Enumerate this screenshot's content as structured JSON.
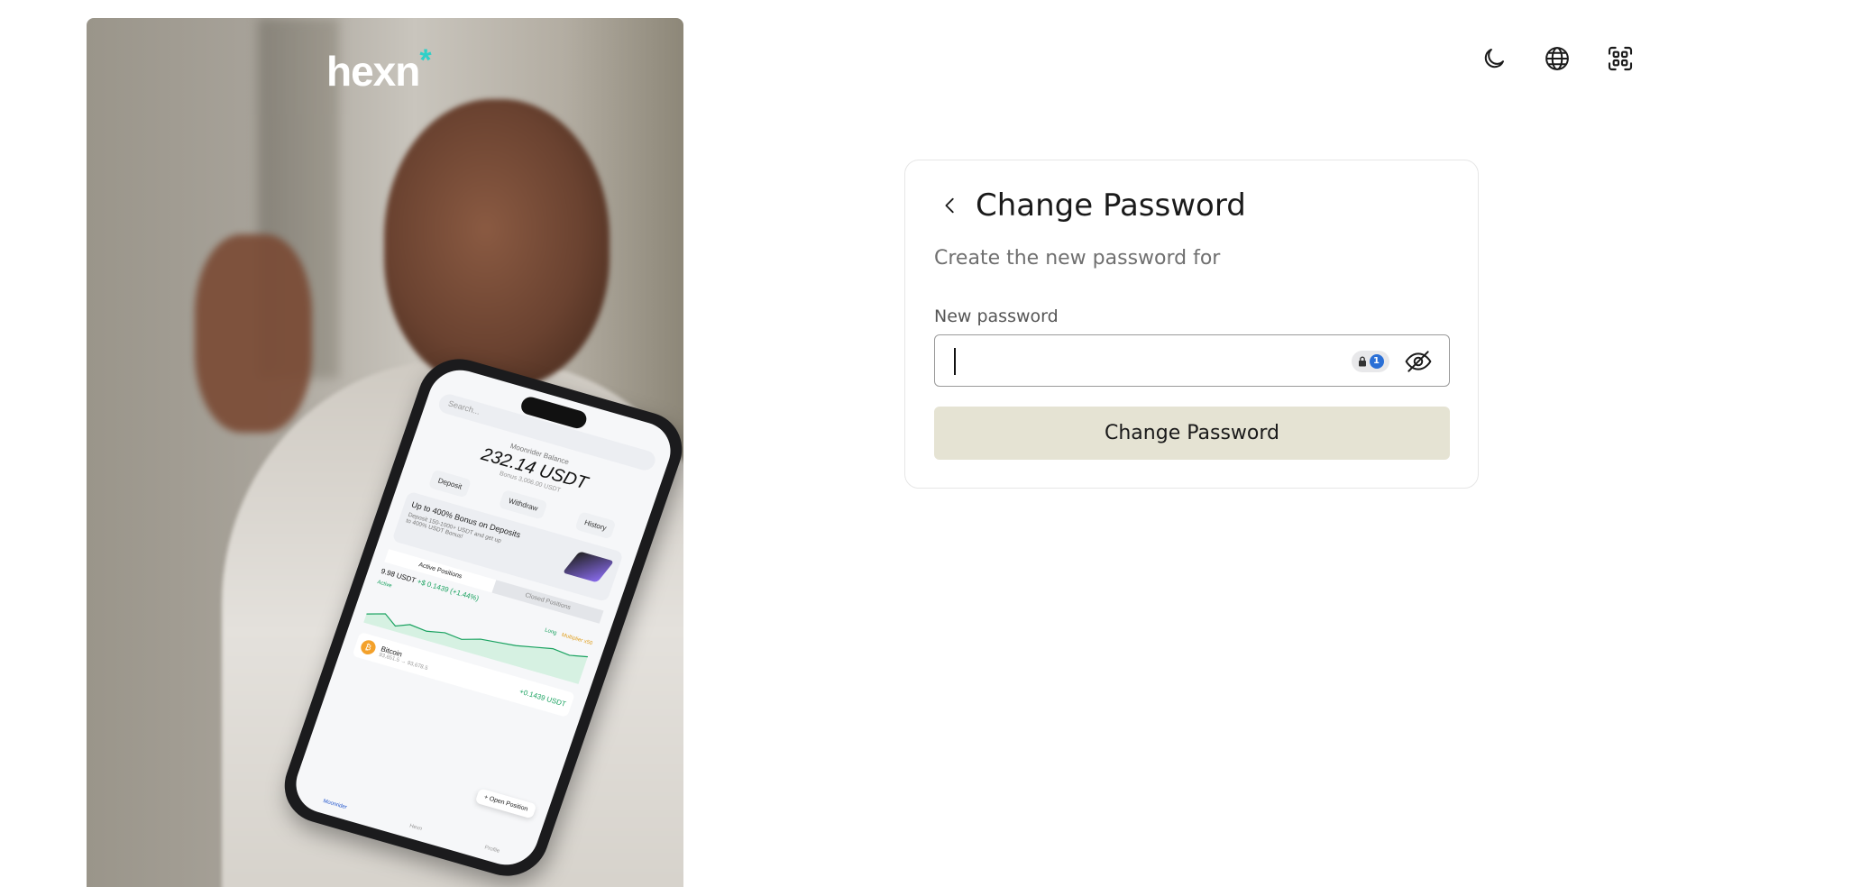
{
  "brand": {
    "logo_text": "hexn",
    "logo_mark": "*",
    "accent_color": "#2fd0c8"
  },
  "header": {
    "icons": [
      "moon-icon",
      "globe-icon",
      "scan-icon"
    ]
  },
  "phone_mockup": {
    "search_placeholder": "Search...",
    "balance_label": "Moonrider Balance",
    "balance_value": "232.14 USDT",
    "bonus_text": "Bonus 3,006.00 USDT",
    "actions": [
      "Deposit",
      "Withdraw",
      "History"
    ],
    "promo_title": "Up to 400% Bonus on Deposits",
    "promo_text": "Deposit 150-1000+ USDT and get up to 400% USDT Bonus!",
    "tabs": [
      "Active Positions",
      "Closed Positions"
    ],
    "position_value": "9.98 USDT",
    "position_change": "+$ 0.1439 (+1.44%)",
    "status": "Active",
    "tag_long": "Long",
    "tag_multiplier": "Multiplier x50",
    "coin_name": "Bitcoin",
    "coin_range": "93,651.5 → 93,678.5",
    "coin_gain": "+0.1439 USDT",
    "open_position": "Open Position",
    "nav": [
      "Moonrider",
      "Hexn",
      "Profile"
    ]
  },
  "form": {
    "title": "Change Password",
    "subtitle": "Create the new password for",
    "field_label": "New password",
    "field_value": "",
    "field_placeholder": "",
    "submit_label": "Change Password",
    "submit_color": "#e5e3d3",
    "password_manager_badge": "1"
  }
}
